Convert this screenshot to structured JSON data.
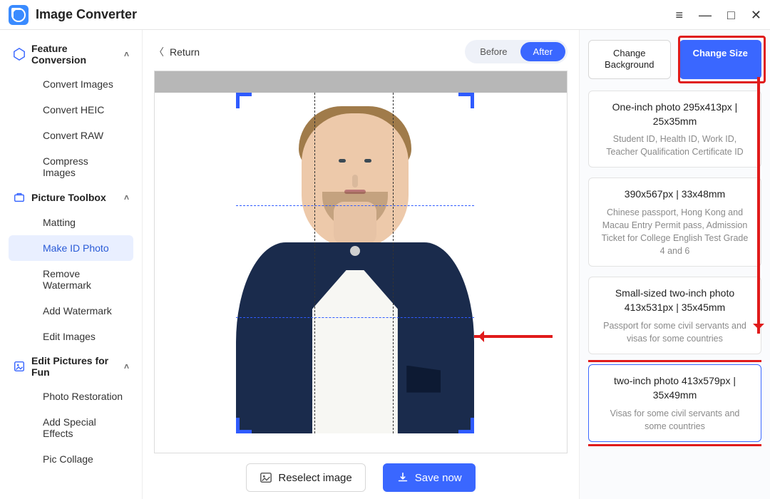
{
  "app": {
    "title": "Image Converter"
  },
  "sidebar": {
    "group1": {
      "label": "Feature Conversion"
    },
    "items1": [
      {
        "label": "Convert Images"
      },
      {
        "label": "Convert HEIC"
      },
      {
        "label": "Convert RAW"
      },
      {
        "label": "Compress Images"
      }
    ],
    "group2": {
      "label": "Picture Toolbox"
    },
    "items2": [
      {
        "label": "Matting"
      },
      {
        "label": "Make ID Photo"
      },
      {
        "label": "Remove Watermark"
      },
      {
        "label": "Add Watermark"
      },
      {
        "label": "Edit Images"
      }
    ],
    "group3": {
      "label": "Edit Pictures for Fun"
    },
    "items3": [
      {
        "label": "Photo Restoration"
      },
      {
        "label": "Add Special Effects"
      },
      {
        "label": "Pic Collage"
      }
    ]
  },
  "editor": {
    "return": "Return",
    "toggle_before": "Before",
    "toggle_after": "After",
    "reselect": "Reselect image",
    "save": "Save now"
  },
  "panel": {
    "change_bg": "Change Background",
    "change_size": "Change Size",
    "cards": [
      {
        "title": "One-inch photo 295x413px | 25x35mm",
        "desc": "Student ID, Health ID, Work ID, Teacher Qualification Certificate ID"
      },
      {
        "title": "390x567px | 33x48mm",
        "desc": "Chinese passport, Hong Kong and Macau Entry Permit pass, Admission Ticket for College English Test Grade 4 and 6"
      },
      {
        "title": "Small-sized two-inch photo 413x531px | 35x45mm",
        "desc": "Passport for some civil servants and visas for some countries"
      },
      {
        "title": "two-inch photo 413x579px | 35x49mm",
        "desc": "Visas for some civil servants and some countries"
      }
    ]
  }
}
